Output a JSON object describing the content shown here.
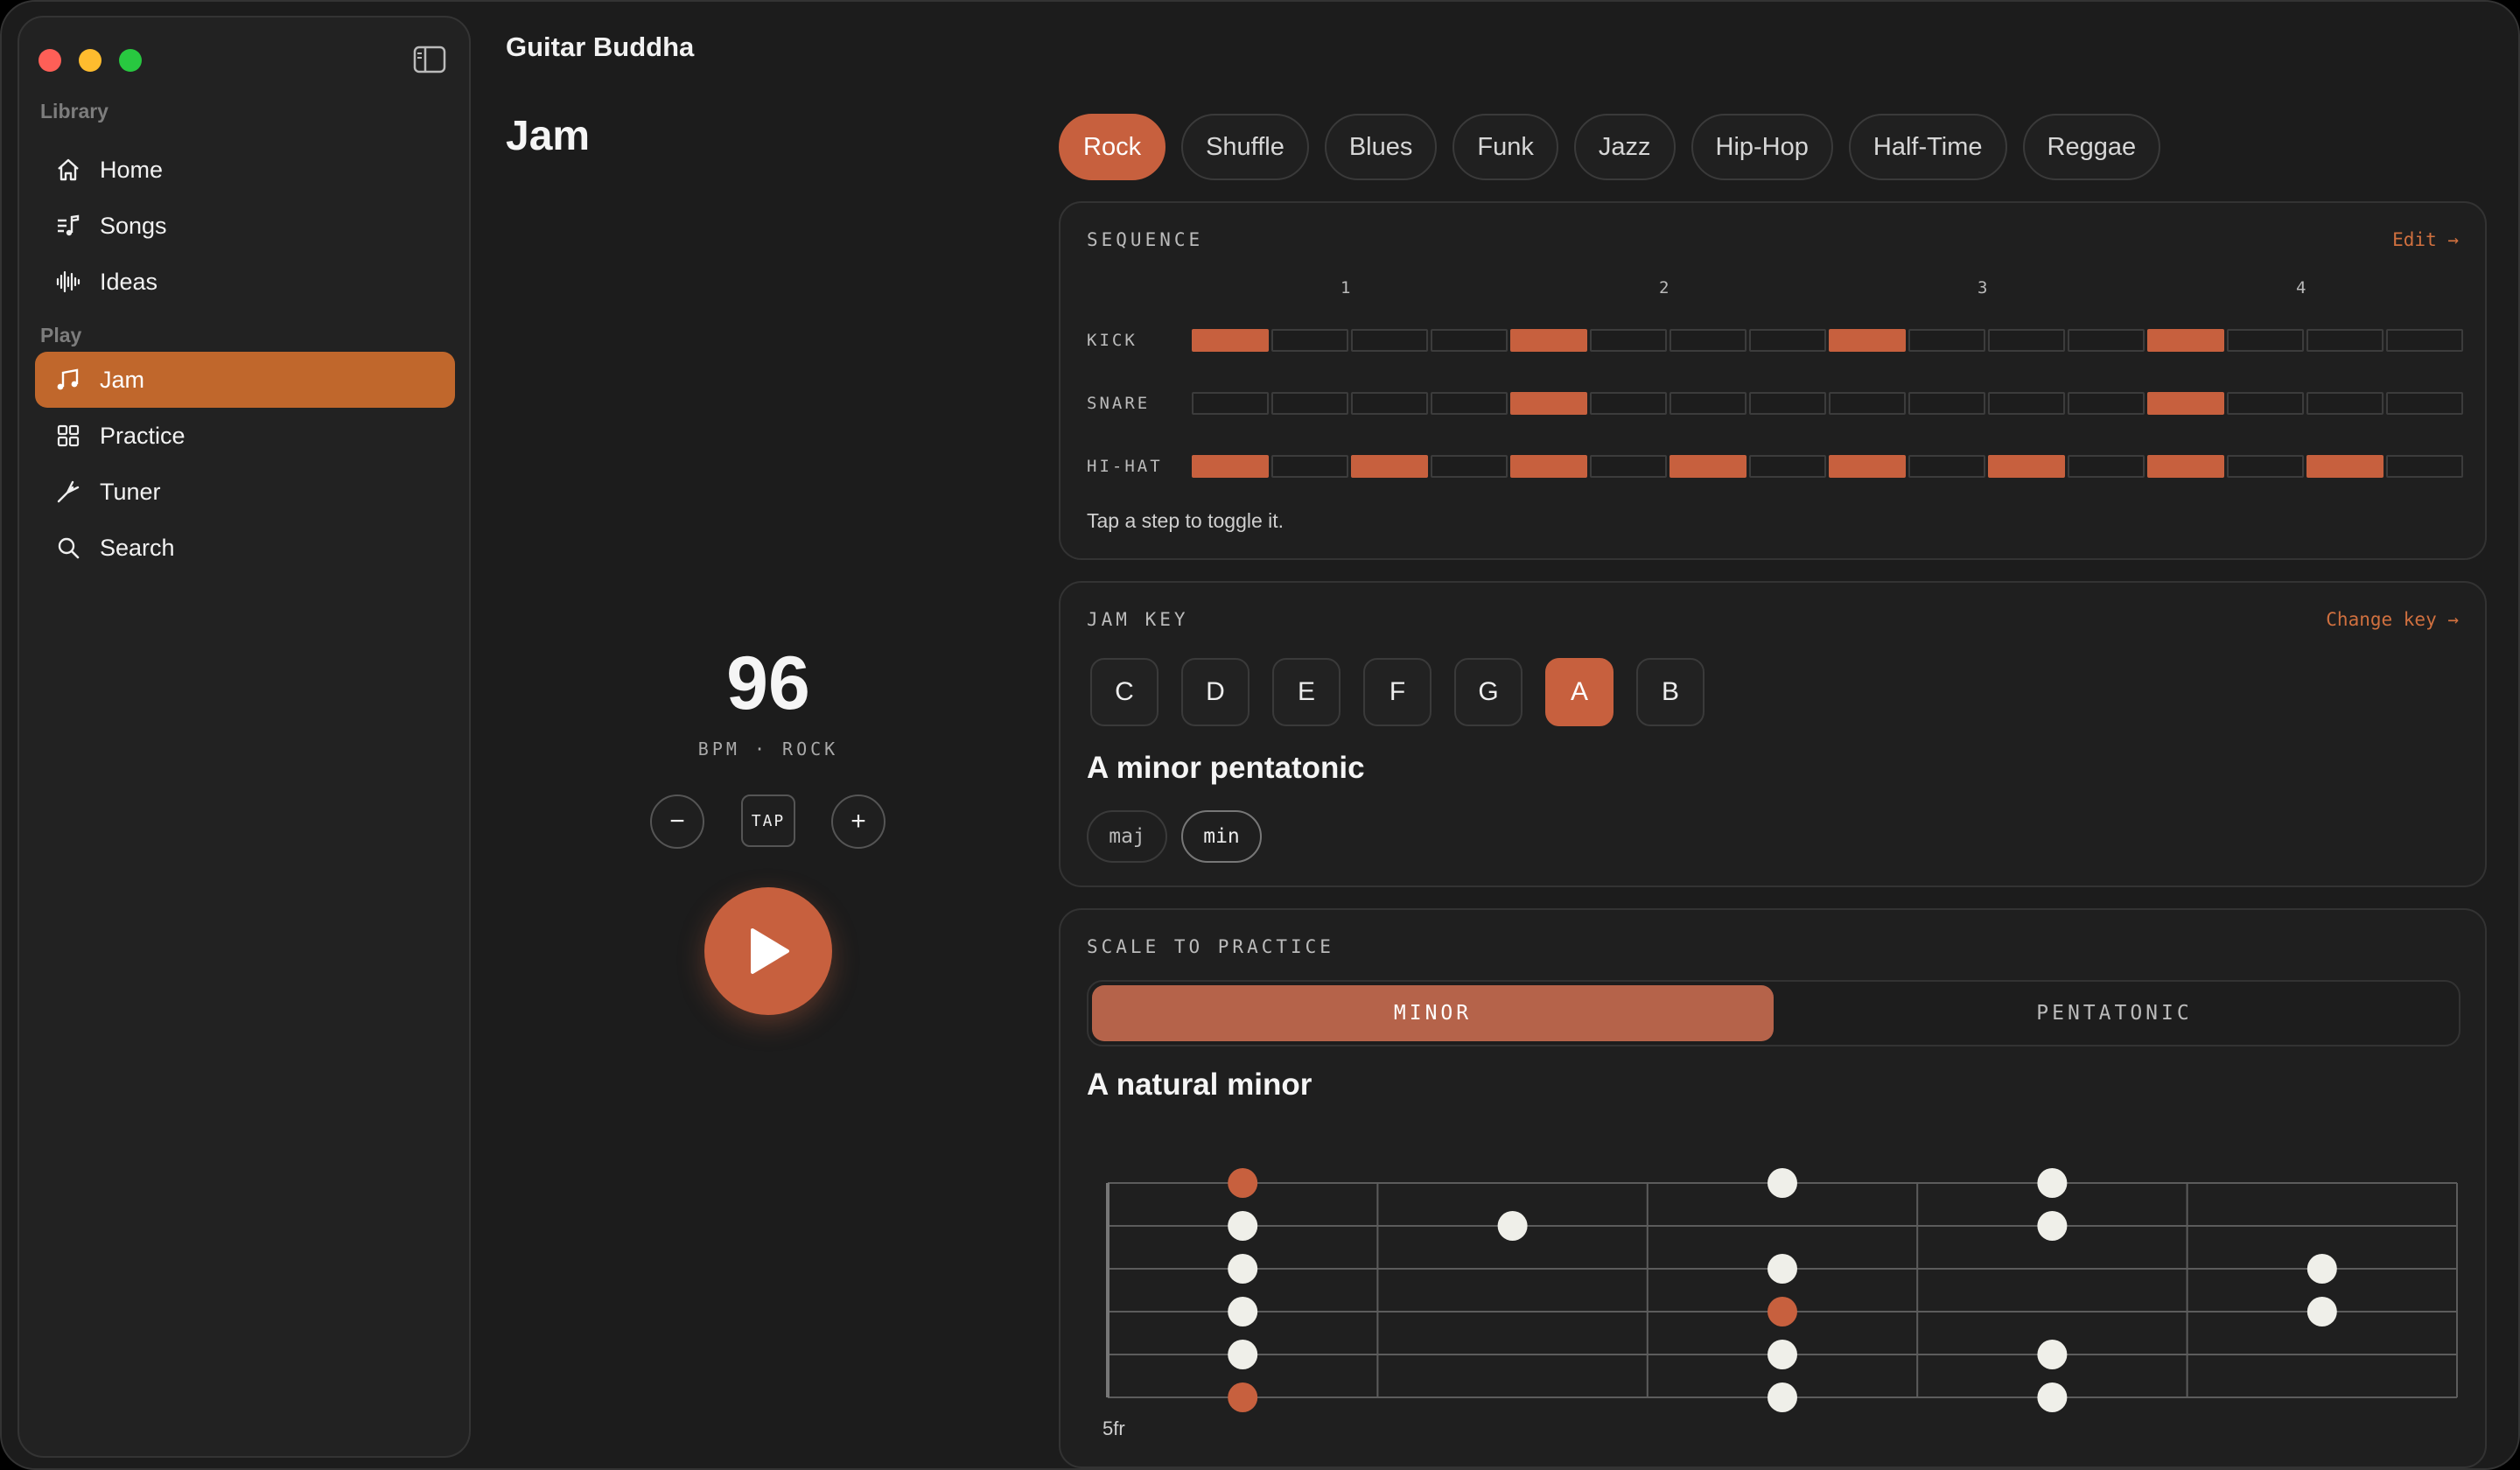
{
  "app": {
    "title": "Guitar Buddha"
  },
  "sidebar": {
    "library_label": "Library",
    "play_label": "Play",
    "library_items": [
      {
        "label": "Home",
        "icon": "home-icon"
      },
      {
        "label": "Songs",
        "icon": "music-list-icon"
      },
      {
        "label": "Ideas",
        "icon": "waveform-icon"
      }
    ],
    "play_items": [
      {
        "label": "Jam",
        "icon": "music-notes-icon",
        "active": true
      },
      {
        "label": "Practice",
        "icon": "grid-icon"
      },
      {
        "label": "Tuner",
        "icon": "tuning-fork-icon"
      },
      {
        "label": "Search",
        "icon": "search-icon"
      }
    ]
  },
  "page": {
    "title": "Jam"
  },
  "tempo": {
    "bpm": "96",
    "caption": "BPM · ROCK",
    "minus": "−",
    "tap": "TAP",
    "plus": "+"
  },
  "genres": [
    "Rock",
    "Shuffle",
    "Blues",
    "Funk",
    "Jazz",
    "Hip-Hop",
    "Half-Time",
    "Reggae"
  ],
  "active_genre": "Rock",
  "sequence": {
    "label": "SEQUENCE",
    "edit_link": "Edit →",
    "beats": [
      "1",
      "2",
      "3",
      "4"
    ],
    "rows": [
      {
        "name": "KICK",
        "steps": [
          1,
          0,
          0,
          0,
          1,
          0,
          0,
          0,
          1,
          0,
          0,
          0,
          1,
          0,
          0,
          0
        ]
      },
      {
        "name": "SNARE",
        "steps": [
          0,
          0,
          0,
          0,
          1,
          0,
          0,
          0,
          0,
          0,
          0,
          0,
          1,
          0,
          0,
          0
        ]
      },
      {
        "name": "HI-HAT",
        "steps": [
          1,
          0,
          1,
          0,
          1,
          0,
          1,
          0,
          1,
          0,
          1,
          0,
          1,
          0,
          1,
          0
        ]
      }
    ],
    "hint": "Tap a step to toggle it."
  },
  "jam_key": {
    "label": "JAM KEY",
    "change_link": "Change key →",
    "keys": [
      "C",
      "D",
      "E",
      "F",
      "G",
      "A",
      "B"
    ],
    "active_key": "A",
    "scale_name": "A minor pentatonic",
    "modes": [
      "maj",
      "min"
    ],
    "active_mode": "min"
  },
  "practice": {
    "label": "SCALE TO PRACTICE",
    "options": [
      "MINOR",
      "PENTATONIC"
    ],
    "active_option": "MINOR",
    "scale_title": "A natural minor",
    "start_fret": "5fr",
    "accent_color": "#c7603e",
    "notes": [
      {
        "string": 0,
        "fret": 0,
        "root": true
      },
      {
        "string": 0,
        "fret": 2
      },
      {
        "string": 0,
        "fret": 3
      },
      {
        "string": 1,
        "fret": 0
      },
      {
        "string": 1,
        "fret": 1
      },
      {
        "string": 1,
        "fret": 3
      },
      {
        "string": 2,
        "fret": 0
      },
      {
        "string": 2,
        "fret": 2
      },
      {
        "string": 2,
        "fret": 4
      },
      {
        "string": 3,
        "fret": 0
      },
      {
        "string": 3,
        "fret": 2,
        "root": true
      },
      {
        "string": 3,
        "fret": 4
      },
      {
        "string": 4,
        "fret": 0
      },
      {
        "string": 4,
        "fret": 2
      },
      {
        "string": 4,
        "fret": 3
      },
      {
        "string": 5,
        "fret": 0,
        "root": true
      },
      {
        "string": 5,
        "fret": 2
      },
      {
        "string": 5,
        "fret": 3
      }
    ]
  }
}
